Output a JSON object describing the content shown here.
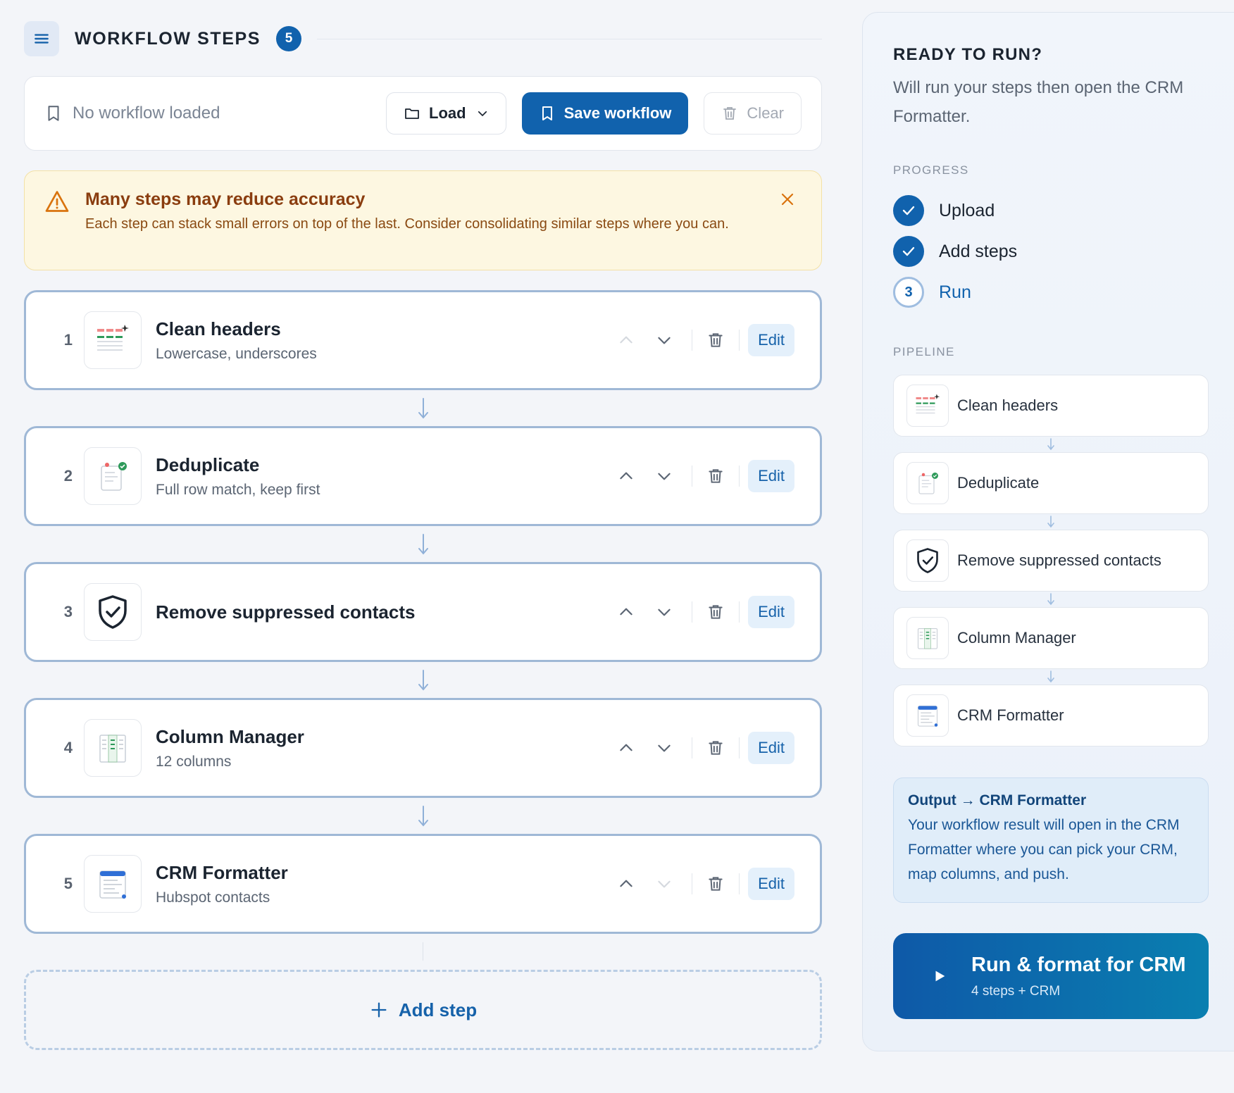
{
  "header": {
    "title": "WORKFLOW STEPS",
    "count": "5"
  },
  "toolbar": {
    "status": "No workflow loaded",
    "load_label": "Load",
    "save_label": "Save workflow",
    "clear_label": "Clear"
  },
  "warning": {
    "title": "Many steps may reduce accuracy",
    "text": "Each step can stack small errors on top of the last. Consider consolidating similar steps where you can."
  },
  "steps": [
    {
      "number": "1",
      "title": "Clean headers",
      "subtitle": "Lowercase, underscores",
      "icon": "table-icon",
      "edit_label": "Edit"
    },
    {
      "number": "2",
      "title": "Deduplicate",
      "subtitle": "Full row match, keep first",
      "icon": "document-check-icon",
      "edit_label": "Edit"
    },
    {
      "number": "3",
      "title": "Remove suppressed contacts",
      "subtitle": "",
      "icon": "shield-check-icon",
      "edit_label": "Edit"
    },
    {
      "number": "4",
      "title": "Column Manager",
      "subtitle": "12 columns",
      "icon": "columns-icon",
      "edit_label": "Edit"
    },
    {
      "number": "5",
      "title": "CRM Formatter",
      "subtitle": "Hubspot contacts",
      "icon": "crm-form-icon",
      "edit_label": "Edit"
    }
  ],
  "add_step_label": "Add step",
  "sidebar": {
    "title": "READY TO RUN?",
    "subtitle": "Will run your steps then open the CRM Formatter.",
    "progress_label": "PROGRESS",
    "progress": [
      {
        "label": "Upload",
        "state": "done"
      },
      {
        "label": "Add steps",
        "state": "done"
      },
      {
        "label": "Run",
        "state": "current",
        "number": "3"
      }
    ],
    "pipeline_label": "PIPELINE",
    "pipeline": [
      {
        "label": "Clean headers"
      },
      {
        "label": "Deduplicate"
      },
      {
        "label": "Remove suppressed contacts"
      },
      {
        "label": "Column Manager"
      },
      {
        "label": "CRM Formatter"
      }
    ],
    "output": {
      "title": "Output → CRM Formatter",
      "text": "Your workflow result will open in the CRM Formatter where you can pick your CRM, map columns, and push."
    },
    "run": {
      "title": "Run & format for CRM",
      "subtitle": "4 steps + CRM"
    }
  },
  "colors": {
    "accent": "#1162ad",
    "warning_bg": "#fdf7e1",
    "warning_text": "#8a3d0f",
    "step_border": "#9fb8d6"
  }
}
